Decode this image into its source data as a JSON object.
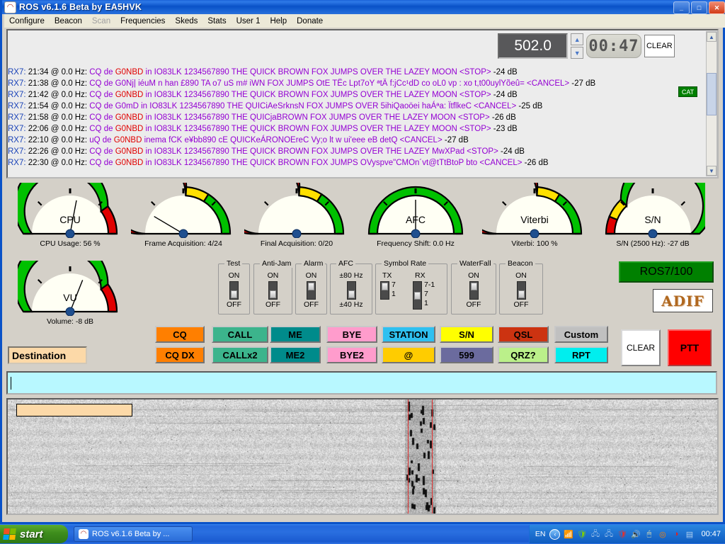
{
  "window": {
    "title": "ROS v6.1.6 Beta by EA5HVK",
    "icon": "radio-icon",
    "buttons": {
      "minimize": "_",
      "maximize": "□",
      "close": "✕"
    }
  },
  "menu": {
    "items": [
      {
        "label": "Configure",
        "enabled": true
      },
      {
        "label": "Beacon",
        "enabled": true
      },
      {
        "label": "Scan",
        "enabled": false
      },
      {
        "label": "Frequencies",
        "enabled": true
      },
      {
        "label": "Skeds",
        "enabled": true
      },
      {
        "label": "Stats",
        "enabled": true
      },
      {
        "label": "User 1",
        "enabled": true
      },
      {
        "label": "Help",
        "enabled": true
      },
      {
        "label": "Donate",
        "enabled": true
      }
    ]
  },
  "topbar": {
    "frequency": "502.0",
    "clock": "00:47",
    "clear_label": "CLEAR",
    "cat_badge": "CAT",
    "spin_up": "▲",
    "spin_down": "▼"
  },
  "log": {
    "lines": [
      {
        "rx": "RX7:",
        "time": "21:34 @ 0.0 Hz:",
        "pre": "CQ de ",
        "call": "G0NBD",
        "post": " in IO83LK  1234567890 THE  QUICK  BROWN  FOX JUMPS OVER THE  LAZEY MOON  <STOP>",
        "db": "-24 dB"
      },
      {
        "rx": "RX7:",
        "time": "21:38 @ 0.0 Hz:",
        "pre": "CQ de G0Nj| iéuM n han £890 TA     o7 uS m# iWN  FOX JUMPS OtE TËc  Lpt7oY ªtÄ f:jCc¹dD co oL0 vp  : xo t,t00uylYõeû= <CANCEL>",
        "call": "",
        "post": "",
        "db": "-27 dB"
      },
      {
        "rx": "RX7:",
        "time": "21:42 @ 0.0 Hz:",
        "pre": "CQ de ",
        "call": "G0NBD",
        "post": " in IO83LK  1234567890 THE  QUICK  BROWN  FOX JUMPS OVER THE  LAZEY MOON  <STOP>",
        "db": "-24 dB"
      },
      {
        "rx": "RX7:",
        "time": "21:54 @ 0.0 Hz:",
        "pre": "CQ de G0mD in IO83LK  1234567890 THE  QUICiAeSrknsN  FOX JUMPS OVER 5ihiQaoöei haÁªa: ÏtflkeC <CANCEL>",
        "call": "",
        "post": "",
        "db": "-25 dB"
      },
      {
        "rx": "RX7:",
        "time": "21:58 @ 0.0 Hz:",
        "pre": "CQ de ",
        "call": "G0NBD",
        "post": " in IO83LK  1234567890 THE  QUICjaBROWN  FOX JUMPS OVER THE  LAZEY MOON  <STOP>",
        "db": "-26 dB"
      },
      {
        "rx": "RX7:",
        "time": "22:06 @ 0.0 Hz:",
        "pre": "CQ de ",
        "call": "G0NBD",
        "post": " in IO83LK  1234567890 THE  QUICK  BROWN  FOX JUMPS OVER THE  LAZEY MOON  <STOP>",
        "db": "-23 dB"
      },
      {
        "rx": "RX7:",
        "time": "22:10 @ 0.0 Hz:",
        "pre": "uQ de ",
        "call": "G0NBD",
        "post": " inema fCK e¥bb890 cE  QUICKeÁRONOEreC Vy;o lt  w ui'eee eB detQ <CANCEL>",
        "db": "-27 dB"
      },
      {
        "rx": "RX7:",
        "time": "22:26 @ 0.0 Hz:",
        "pre": "CQ de ",
        "call": "G0NBD",
        "post": " in IO83LK  1234567890 THE  QUICK  BROWN  FOX JUMPS OVER THE  LAZEY MwXPad <STOP>",
        "db": "-24 dB"
      },
      {
        "rx": "RX7:",
        "time": "22:30 @ 0.0 Hz:",
        "pre": "CQ de ",
        "call": "G0NBD",
        "post": " in IO83LK  1234567890 THE  QUICK  BROWN  FOX JUMPS OVyspve\"CMOn´vt@tTtBtoP  bto <CANCEL>",
        "db": "-26 dB"
      }
    ]
  },
  "gauges": [
    {
      "name": "CPU",
      "label": "CPU Usage: 56 %",
      "needle": 0.56,
      "bands": "green-red"
    },
    {
      "name": "",
      "label": "Frame Acquisition: 4/24",
      "needle": 0.17,
      "bands": "red-yellow-green"
    },
    {
      "name": "",
      "label": "Final Acquisition: 0/20",
      "needle": 0.0,
      "bands": "red-yellow-green"
    },
    {
      "name": "AFC",
      "label": "Frequency Shift: 0.0 Hz",
      "needle": 0.5,
      "bands": "all-green"
    },
    {
      "name": "Viterbi",
      "label": "Viterbi: 100 %",
      "needle": 1.0,
      "bands": "red-yellow-green"
    },
    {
      "name": "S/N",
      "label": "S/N (2500 Hz): -27 dB",
      "needle": 1.0,
      "bands": "red-yellow-green2"
    },
    {
      "name": "VU",
      "label": "Volume: -8 dB",
      "needle": 0.62,
      "bands": "green-red"
    }
  ],
  "switches": {
    "test": {
      "title": "Test",
      "on": "ON",
      "off": "OFF",
      "state": "off"
    },
    "antijam": {
      "title": "Anti-Jam",
      "on": "ON",
      "off": "OFF",
      "state": "off"
    },
    "alarm": {
      "title": "Alarm",
      "on": "ON",
      "off": "OFF",
      "state": "on"
    },
    "afc": {
      "title": "AFC",
      "on": "±80 Hz",
      "off": "±40 Hz",
      "state": "off"
    },
    "symbolrate": {
      "title": "Symbol Rate",
      "tx": {
        "label": "TX",
        "options": [
          "7",
          "1"
        ],
        "state": "top"
      },
      "rx": {
        "label": "RX",
        "options": [
          "7-1",
          "7",
          "1"
        ],
        "state": "mid"
      }
    },
    "waterfall": {
      "title": "WaterFall",
      "on": "ON",
      "off": "OFF",
      "state": "on"
    },
    "beacon": {
      "title": "Beacon",
      "on": "ON",
      "off": "OFF",
      "state": "off"
    }
  },
  "mode": {
    "label": "ROS7/100",
    "color": "#008000"
  },
  "adif": {
    "label": "ADIF"
  },
  "macros": {
    "row1": [
      {
        "label": "CQ",
        "bg": "#ff7f00",
        "fg": "#000000"
      },
      {
        "label": "CALL",
        "bg": "#3cb48c",
        "fg": "#000000"
      },
      {
        "label": "ME",
        "bg": "#008b8b",
        "fg": "#000000"
      },
      {
        "label": "BYE",
        "bg": "#ff9ccc",
        "fg": "#000000"
      },
      {
        "label": "STATION",
        "bg": "#2ec0f0",
        "fg": "#000000"
      },
      {
        "label": "S/N",
        "bg": "#ffff00",
        "fg": "#000000"
      },
      {
        "label": "QSL",
        "bg": "#cc3311",
        "fg": "#000000"
      },
      {
        "label": "Custom",
        "bg": "#c0c0c0",
        "fg": "#000000"
      }
    ],
    "row2": [
      {
        "label": "CQ DX",
        "bg": "#ff7f00",
        "fg": "#000000"
      },
      {
        "label": "CALLx2",
        "bg": "#3cb48c",
        "fg": "#000000"
      },
      {
        "label": "ME2",
        "bg": "#008b8b",
        "fg": "#000000"
      },
      {
        "label": "BYE2",
        "bg": "#ff9ccc",
        "fg": "#000000"
      },
      {
        "label": "@",
        "bg": "#ffcc00",
        "fg": "#000000"
      },
      {
        "label": "599",
        "bg": "#6b6b9e",
        "fg": "#000000"
      },
      {
        "label": "QRZ?",
        "bg": "#bbf08a",
        "fg": "#000000"
      },
      {
        "label": "RPT",
        "bg": "#00eeee",
        "fg": "#000000"
      }
    ]
  },
  "actions": {
    "clear_label": "CLEAR",
    "ptt_label": "PTT"
  },
  "destination": {
    "value": "Destination"
  },
  "tx_input": {
    "value": ""
  },
  "taskbar": {
    "start_label": "start",
    "task_label": "ROS v6.1.6 Beta by ...",
    "tray_lang": "EN",
    "tray_clock": "00:47"
  }
}
